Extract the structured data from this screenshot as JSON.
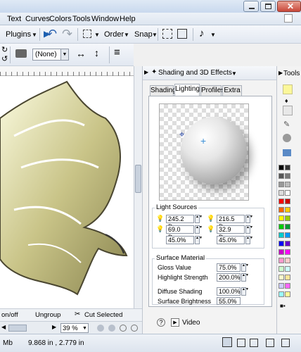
{
  "menu": {
    "items": [
      "Text",
      "Curves",
      "Colors",
      "Tools",
      "Window",
      "Help"
    ]
  },
  "toolbar": {
    "plugins_label": "Plugins",
    "order_label": "Order",
    "snap_label": "Snap",
    "preset_value": "(None)"
  },
  "canvas": {
    "onoff_label": "on/off",
    "ungroup_label": "Ungroup",
    "cut_selected_label": "Cut Selected",
    "zoom_value": "39 %"
  },
  "status": {
    "size_left": "Mb",
    "coords": "9.868 in , 2.779 in"
  },
  "docker": {
    "title": "Shading and 3D Effects",
    "tools_label": "Tools",
    "tabs": [
      "Shading",
      "Lighting",
      "Profiles",
      "Extra"
    ],
    "active_tab": "Lighting",
    "light_sources": {
      "label": "Light Sources",
      "left": [
        "245.2 Deg.",
        "69.0 Deg.",
        "45.0%"
      ],
      "right": [
        "216.5 Deg.",
        "32.9 Deg.",
        "45.0%"
      ]
    },
    "surface": {
      "label": "Surface Material",
      "props": [
        {
          "label": "Gloss Value",
          "value": "75.0%"
        },
        {
          "label": "Highlight Strength",
          "value": "200.0%"
        },
        {
          "label": "Diffuse Shading",
          "value": "100.0%"
        },
        {
          "label": "Surface Brightness",
          "value": "55.0%"
        }
      ]
    },
    "video_label": "Video",
    "help_icon": "?"
  },
  "palette": {
    "colors": [
      "#000000",
      "#333333",
      "#555555",
      "#777777",
      "#999999",
      "#bbbbbb",
      "#dddddd",
      "#ffffff",
      "#ff0000",
      "#cc0000",
      "#ff6600",
      "#ffcc00",
      "#ffff00",
      "#99cc00",
      "#00cc00",
      "#009933",
      "#00cccc",
      "#0099ff",
      "#0000ff",
      "#6600cc",
      "#cc00cc",
      "#ff00ff",
      "#ff99cc",
      "#ffcccc",
      "#ccffcc",
      "#ccffff",
      "#ffffcc",
      "#ffe699",
      "#ccccff",
      "#ff66ff",
      "#99ffff",
      "#ffff99"
    ]
  }
}
